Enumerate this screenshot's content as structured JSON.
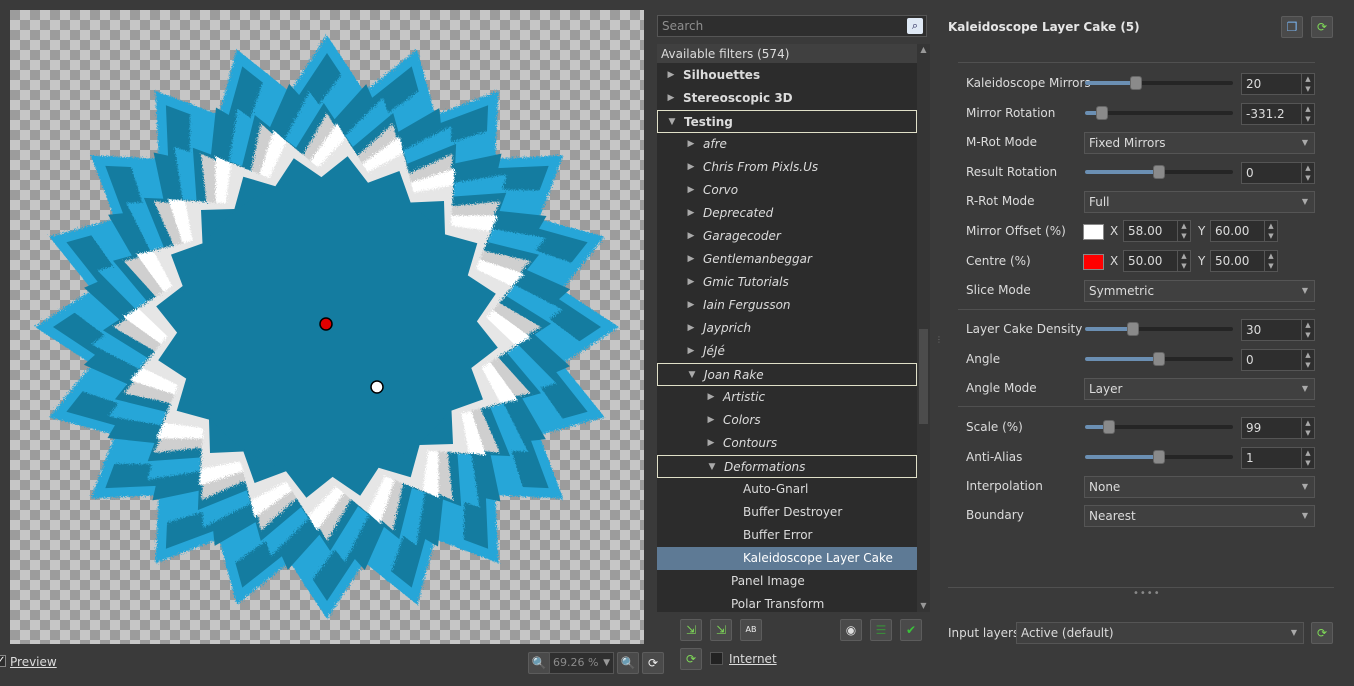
{
  "preview": {
    "label": "Preview",
    "checked": "✓",
    "zoom": "69.26 %"
  },
  "filters": {
    "search_placeholder": "Search",
    "header": "Available filters (574)",
    "tree": [
      {
        "label": "Silhouettes",
        "level": 0,
        "expanded": false,
        "style": "bold"
      },
      {
        "label": "Stereoscopic 3D",
        "level": 0,
        "expanded": false,
        "style": "bold"
      },
      {
        "label": "Testing",
        "level": 0,
        "expanded": true,
        "style": "bold",
        "boxed": true
      },
      {
        "label": "afre",
        "level": 1,
        "expanded": false,
        "style": "ital"
      },
      {
        "label": "Chris From Pixls.Us",
        "level": 1,
        "expanded": false,
        "style": "ital"
      },
      {
        "label": "Corvo",
        "level": 1,
        "expanded": false,
        "style": "ital"
      },
      {
        "label": "Deprecated",
        "level": 1,
        "expanded": false,
        "style": "ital"
      },
      {
        "label": "Garagecoder",
        "level": 1,
        "expanded": false,
        "style": "ital"
      },
      {
        "label": "Gentlemanbeggar",
        "level": 1,
        "expanded": false,
        "style": "ital"
      },
      {
        "label": "Gmic Tutorials",
        "level": 1,
        "expanded": false,
        "style": "ital"
      },
      {
        "label": "Iain Fergusson",
        "level": 1,
        "expanded": false,
        "style": "ital"
      },
      {
        "label": "Jayprich",
        "level": 1,
        "expanded": false,
        "style": "ital"
      },
      {
        "label": "JéJé",
        "level": 1,
        "expanded": false,
        "style": "ital"
      },
      {
        "label": "Joan Rake",
        "level": 1,
        "expanded": true,
        "style": "ital",
        "boxed": true
      },
      {
        "label": "Artistic",
        "level": 2,
        "expanded": false,
        "style": "ital"
      },
      {
        "label": "Colors",
        "level": 2,
        "expanded": false,
        "style": "ital"
      },
      {
        "label": "Contours",
        "level": 2,
        "expanded": false,
        "style": "ital"
      },
      {
        "label": "Deformations",
        "level": 2,
        "expanded": true,
        "style": "ital",
        "boxed": true
      },
      {
        "label": "Auto-Gnarl",
        "level": 3,
        "leaf": true
      },
      {
        "label": "Buffer Destroyer",
        "level": 3,
        "leaf": true
      },
      {
        "label": "Buffer Error",
        "level": 3,
        "leaf": true
      },
      {
        "label": "Kaleidoscope Layer Cake",
        "level": 3,
        "leaf": true,
        "selected": true
      },
      {
        "label": "Panel Image",
        "level": 2.4,
        "leaf": true
      },
      {
        "label": "Polar Transform",
        "level": 2.4,
        "leaf": true
      }
    ],
    "internet_label": "Internet"
  },
  "settings": {
    "title": "Kaleidoscope Layer Cake (5)",
    "kaleidoscope_mirrors": {
      "label": "Kaleidoscope Mirrors",
      "value": "20",
      "level": 0.33
    },
    "mirror_rotation": {
      "label": "Mirror Rotation",
      "value": "-331.2",
      "level": 0.08
    },
    "m_rot_mode": {
      "label": "M-Rot Mode",
      "value": "Fixed Mirrors"
    },
    "result_rotation": {
      "label": "Result Rotation",
      "value": "0",
      "level": 0.5
    },
    "r_rot_mode": {
      "label": "R-Rot Mode",
      "value": "Full"
    },
    "mirror_offset": {
      "label": "Mirror Offset (%)",
      "color": "#ffffff",
      "x_label": "X",
      "x": "58.00",
      "y_label": "Y",
      "y": "60.00"
    },
    "centre": {
      "label": "Centre (%)",
      "color": "#ff0000",
      "x_label": "X",
      "x": "50.00",
      "y_label": "Y",
      "y": "50.00"
    },
    "slice_mode": {
      "label": "Slice Mode",
      "value": "Symmetric"
    },
    "layer_cake_density": {
      "label": "Layer Cake Density",
      "value": "30",
      "level": 0.31
    },
    "angle": {
      "label": "Angle",
      "value": "0",
      "level": 0.5
    },
    "angle_mode": {
      "label": "Angle Mode",
      "value": "Layer"
    },
    "scale": {
      "label": "Scale (%)",
      "value": "99",
      "level": 0.13
    },
    "anti_alias": {
      "label": "Anti-Alias",
      "value": "1",
      "level": 0.5
    },
    "interpolation": {
      "label": "Interpolation",
      "value": "None"
    },
    "boundary": {
      "label": "Boundary",
      "value": "Nearest"
    },
    "input_layers": {
      "label": "Input layers",
      "value": "Active (default)"
    }
  },
  "colors": {
    "accent": "#5e7a95",
    "preview_blue_dark": "#147ca0",
    "preview_blue_light": "#27a6d8"
  }
}
